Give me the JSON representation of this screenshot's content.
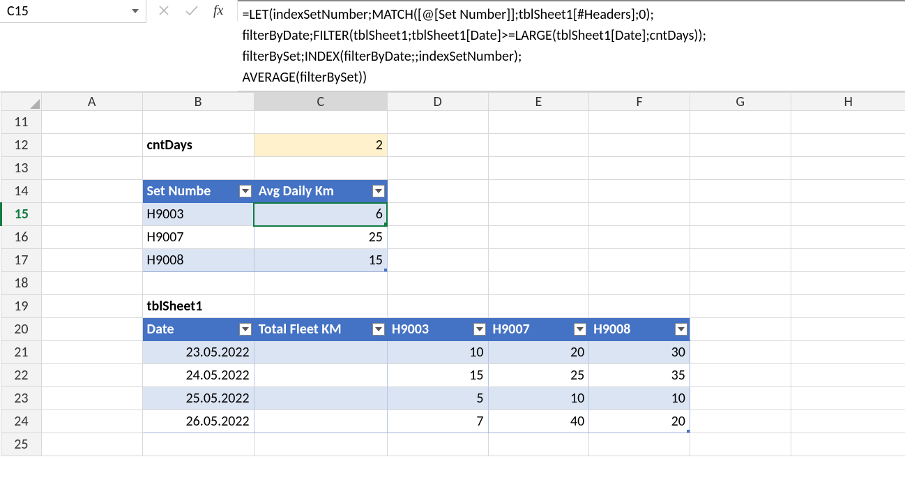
{
  "nameBox": {
    "value": "C15"
  },
  "formulaBar": {
    "fxLabel": "fx",
    "text": "=LET(indexSetNumber;MATCH([@[Set Number]];tblSheet1[#Headers];0);\nfilterByDate;FILTER(tblSheet1;tblSheet1[Date]>=LARGE(tblSheet1[Date];cntDays));\nfilterBySet;INDEX(filterByDate;;indexSetNumber);\nAVERAGE(filterBySet))"
  },
  "columns": [
    "A",
    "B",
    "C",
    "D",
    "E",
    "F",
    "G",
    "H"
  ],
  "rows": [
    11,
    12,
    13,
    14,
    15,
    16,
    17,
    18,
    19,
    20,
    21,
    22,
    23,
    24,
    25
  ],
  "cells": {
    "B12": "cntDays",
    "C12": "2",
    "B14": "Set Numbe",
    "C14": "Avg Daily Km",
    "B15": "H9003",
    "C15": "6",
    "B16": "H9007",
    "C16": "25",
    "B17": "H9008",
    "C17": "15",
    "B19": "tblSheet1",
    "B20": "Date",
    "C20": "Total Fleet KM",
    "D20": "H9003",
    "E20": "H9007",
    "F20": "H9008",
    "B21": "23.05.2022",
    "D21": "10",
    "E21": "20",
    "F21": "30",
    "B22": "24.05.2022",
    "D22": "15",
    "E22": "25",
    "F22": "35",
    "B23": "25.05.2022",
    "D23": "5",
    "E23": "10",
    "F23": "10",
    "B24": "26.05.2022",
    "D24": "7",
    "E24": "40",
    "F24": "20"
  },
  "selectedCell": "C15",
  "selectedRow": 15,
  "selectedCol": "C",
  "chart_data": null
}
